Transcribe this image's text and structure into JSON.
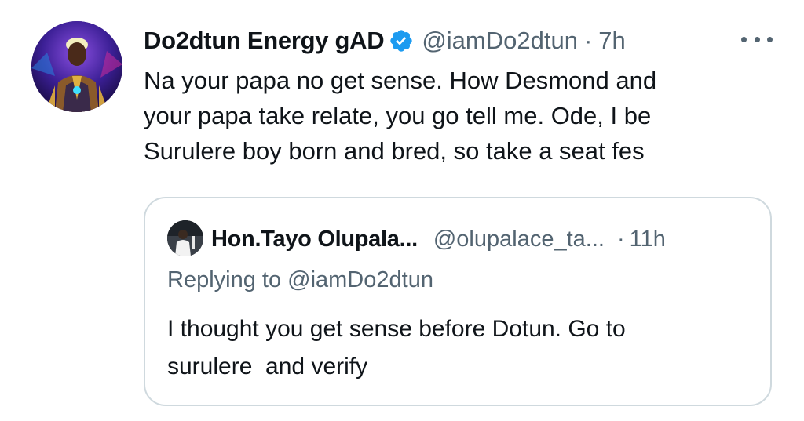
{
  "tweet": {
    "author_name": "Do2dtun Energy gAD",
    "handle": "@iamDo2dtun",
    "separator": "·",
    "time": "7h",
    "text_lines": [
      "Na your papa no get sense. How Desmond and",
      "your papa take relate, you go tell me. Ode, I be",
      "Surulere boy born and bred, so take a seat fes"
    ],
    "verified_icon": "verified-badge-icon",
    "more_icon": "more-horizontal-icon"
  },
  "quoted_tweet": {
    "author_name": "Hon.Tayo Olupala...",
    "handle": "@olupalace_ta...",
    "separator": "·",
    "time": "11h",
    "replying_to": "Replying to @iamDo2dtun",
    "text_lines": [
      "I thought you get sense before Dotun. Go to",
      "surulere  and verify"
    ]
  },
  "colors": {
    "primary_text": "#0f1419",
    "secondary_text": "#536471",
    "verified_blue": "#1d9bf0",
    "border": "#cfd9de"
  }
}
